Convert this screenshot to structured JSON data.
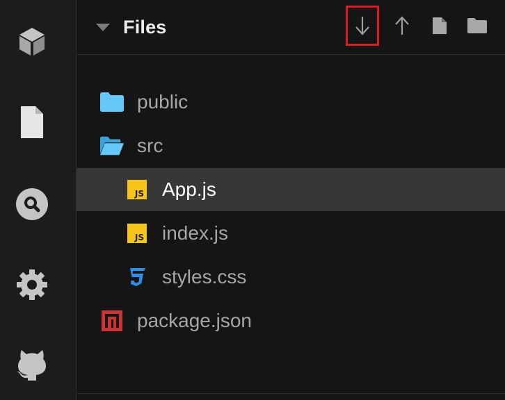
{
  "activity_bar": {
    "items": [
      {
        "icon": "cube-icon"
      },
      {
        "icon": "file-icon"
      },
      {
        "icon": "search-icon"
      },
      {
        "icon": "gear-icon"
      },
      {
        "icon": "github-icon"
      }
    ]
  },
  "explorer": {
    "title": "Files",
    "actions": [
      {
        "icon": "download-icon",
        "highlighted": true
      },
      {
        "icon": "upload-icon",
        "highlighted": false
      },
      {
        "icon": "new-file-icon",
        "highlighted": false
      },
      {
        "icon": "new-folder-icon",
        "highlighted": false
      }
    ],
    "tree": [
      {
        "label": "public",
        "icon": "folder-icon",
        "depth": 0,
        "selected": false
      },
      {
        "label": "src",
        "icon": "folder-open-icon",
        "depth": 0,
        "selected": false
      },
      {
        "label": "App.js",
        "icon": "js-file-icon",
        "depth": 1,
        "selected": true
      },
      {
        "label": "index.js",
        "icon": "js-file-icon",
        "depth": 1,
        "selected": false
      },
      {
        "label": "styles.css",
        "icon": "css-file-icon",
        "depth": 1,
        "selected": false
      },
      {
        "label": "package.json",
        "icon": "npm-icon",
        "depth": 0,
        "selected": false
      }
    ]
  },
  "colors": {
    "folder": "#63c7f7",
    "js_badge": "#f5c518",
    "css": "#2f8fe8",
    "npm": "#cc3333",
    "highlight": "#e0191f",
    "selected_row": "#373737"
  }
}
